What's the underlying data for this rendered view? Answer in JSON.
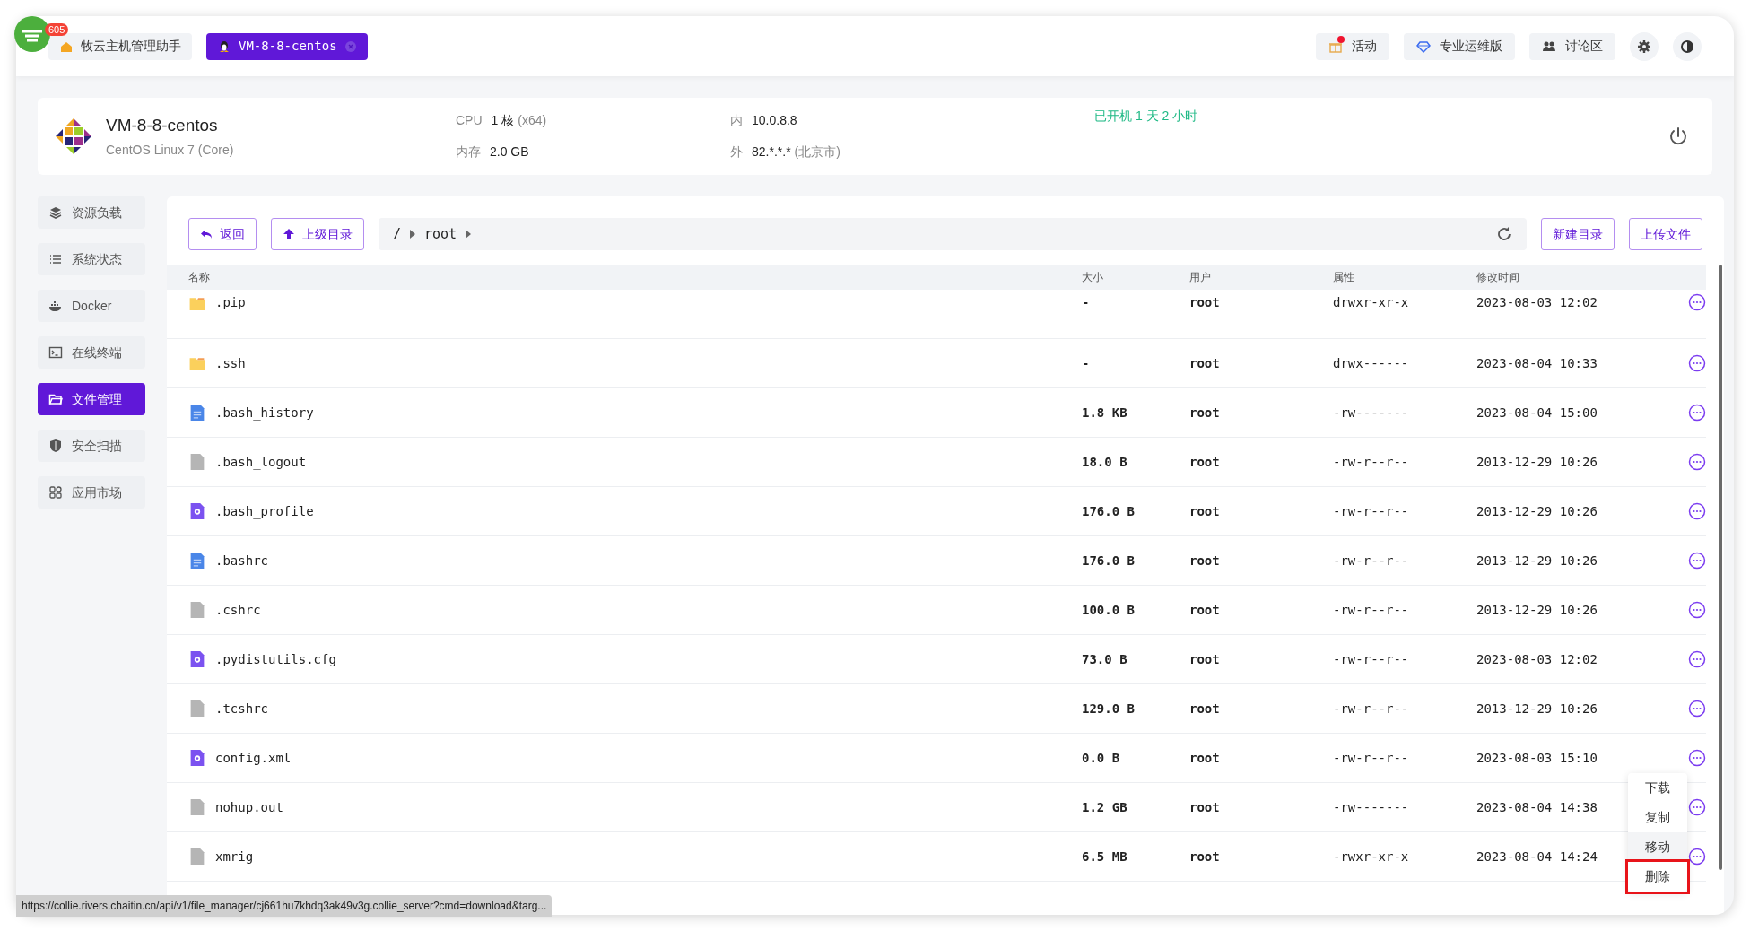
{
  "app_badge": "605",
  "tabs": [
    {
      "label": "牧云主机管理助手",
      "kind": "home",
      "selected": false
    },
    {
      "label": "VM-8-8-centos",
      "kind": "host",
      "selected": true
    }
  ],
  "top_actions": [
    {
      "label": "活动",
      "kind": "gift",
      "dot": true
    },
    {
      "label": "专业运维版",
      "kind": "diamond",
      "dot": false
    },
    {
      "label": "讨论区",
      "kind": "people",
      "dot": false
    }
  ],
  "host": {
    "name": "VM-8-8-centos",
    "os": "CentOS Linux 7 (Core)",
    "cpu_label": "CPU",
    "cpu_value": "1 核",
    "cpu_arch": "(x64)",
    "mem_label": "内存",
    "mem_value": "2.0 GB",
    "inner_label": "内",
    "inner_ip": "10.0.8.8",
    "outer_label": "外",
    "outer_ip": "82.*.*.*",
    "outer_loc": "(北京市)",
    "uptime": "已开机 1 天 2 小时"
  },
  "sidebar": [
    {
      "label": "资源负载",
      "kind": "layers",
      "selected": false
    },
    {
      "label": "系统状态",
      "kind": "list",
      "selected": false
    },
    {
      "label": "Docker",
      "kind": "docker",
      "selected": false
    },
    {
      "label": "在线终端",
      "kind": "terminal",
      "selected": false
    },
    {
      "label": "文件管理",
      "kind": "folder",
      "selected": true
    },
    {
      "label": "安全扫描",
      "kind": "shield",
      "selected": false
    },
    {
      "label": "应用市场",
      "kind": "apps",
      "selected": false
    }
  ],
  "toolbar": {
    "back": "返回",
    "up": "上级目录",
    "path": [
      "/",
      "root"
    ],
    "new_dir": "新建目录",
    "upload": "上传文件"
  },
  "table": {
    "columns": [
      "名称",
      "大小",
      "用户",
      "属性",
      "修改时间"
    ],
    "rows": [
      {
        "kind": "folder",
        "name": ".pip",
        "size": "-",
        "user": "root",
        "mode": "drwxr-xr-x",
        "mtime": "2023-08-03 12:02"
      },
      {
        "kind": "folder",
        "name": ".ssh",
        "size": "-",
        "user": "root",
        "mode": "drwx------",
        "mtime": "2023-08-04 10:33"
      },
      {
        "kind": "text",
        "name": ".bash_history",
        "size": "1.8 KB",
        "user": "root",
        "mode": "-rw-------",
        "mtime": "2023-08-04 15:00"
      },
      {
        "kind": "blank",
        "name": ".bash_logout",
        "size": "18.0 B",
        "user": "root",
        "mode": "-rw-r--r--",
        "mtime": "2013-12-29 10:26"
      },
      {
        "kind": "config",
        "name": ".bash_profile",
        "size": "176.0 B",
        "user": "root",
        "mode": "-rw-r--r--",
        "mtime": "2013-12-29 10:26"
      },
      {
        "kind": "text",
        "name": ".bashrc",
        "size": "176.0 B",
        "user": "root",
        "mode": "-rw-r--r--",
        "mtime": "2013-12-29 10:26"
      },
      {
        "kind": "blank",
        "name": ".cshrc",
        "size": "100.0 B",
        "user": "root",
        "mode": "-rw-r--r--",
        "mtime": "2013-12-29 10:26"
      },
      {
        "kind": "config",
        "name": ".pydistutils.cfg",
        "size": "73.0 B",
        "user": "root",
        "mode": "-rw-r--r--",
        "mtime": "2023-08-03 12:02"
      },
      {
        "kind": "blank",
        "name": ".tcshrc",
        "size": "129.0 B",
        "user": "root",
        "mode": "-rw-r--r--",
        "mtime": "2013-12-29 10:26"
      },
      {
        "kind": "config",
        "name": "config.xml",
        "size": "0.0 B",
        "user": "root",
        "mode": "-rw-r--r--",
        "mtime": "2023-08-03 15:10"
      },
      {
        "kind": "blank",
        "name": "nohup.out",
        "size": "1.2 GB",
        "user": "root",
        "mode": "-rw-------",
        "mtime": "2023-08-04 14:38"
      },
      {
        "kind": "blank",
        "name": "xmrig",
        "size": "6.5 MB",
        "user": "root",
        "mode": "-rwxr-xr-x",
        "mtime": "2023-08-04 14:24"
      }
    ]
  },
  "context_menu": [
    {
      "label": "下载",
      "hovered": false,
      "highlighted": false
    },
    {
      "label": "复制",
      "hovered": false,
      "highlighted": false
    },
    {
      "label": "移动",
      "hovered": true,
      "highlighted": false
    },
    {
      "label": "删除",
      "hovered": false,
      "highlighted": true
    }
  ],
  "status_url": "https://collie.rivers.chaitin.cn/api/v1/file_manager/cj661hu7khdq3ak49v3g.collie_server?cmd=download&targ..."
}
